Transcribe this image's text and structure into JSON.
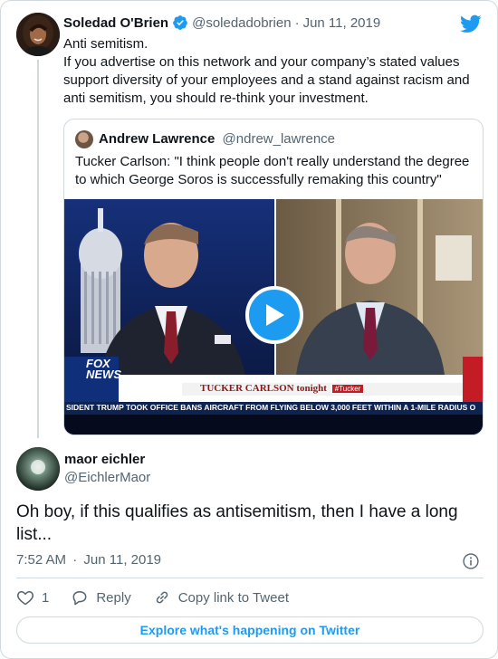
{
  "parent": {
    "name": "Soledad O'Brien",
    "handle": "@soledadobrien",
    "separator": "·",
    "date": "Jun 11, 2019",
    "text_lines": [
      "Anti semitism.",
      "If you advertise on this network and your company’s stated values",
      "support diversity of your employees and a stand against racism and",
      "anti semitism, you should re-think your investment."
    ]
  },
  "quote": {
    "name": "Andrew Lawrence",
    "handle": "@ndrew_lawrence",
    "text_lines": [
      "Tucker Carlson: \"I think people don't really understand the degree",
      "to which George Soros is successfully remaking this country\""
    ],
    "video": {
      "network_top": "FOX",
      "network_bottom": "NEWS",
      "show_name": "TUCKER CARLSON tonight",
      "hashtag": "#Tucker",
      "ticker": "SIDENT TRUMP TOOK OFFICE BANS AIRCRAFT FROM FLYING BELOW 3,000 FEET WITHIN A 1-MILE RADIUS O"
    }
  },
  "reply": {
    "name": "maor eichler",
    "handle": "@EichlerMaor",
    "text_lines": [
      "Oh boy, if this qualifies as antisemitism, then I have a long",
      "list..."
    ],
    "time": "7:52 AM",
    "separator": "·",
    "date": "Jun 11, 2019"
  },
  "actions": {
    "like_count": "1",
    "reply_label": "Reply",
    "copy_label": "Copy link to Tweet"
  },
  "explore_label": "Explore what's happening on Twitter",
  "colors": {
    "accent": "#1d9bf0",
    "text": "#0f1419",
    "secondary": "#536471",
    "border": "#cfd9de"
  },
  "icons": [
    "verified-badge-icon",
    "twitter-bird-icon",
    "play-icon",
    "info-icon",
    "heart-icon",
    "reply-bubble-icon",
    "link-icon"
  ]
}
